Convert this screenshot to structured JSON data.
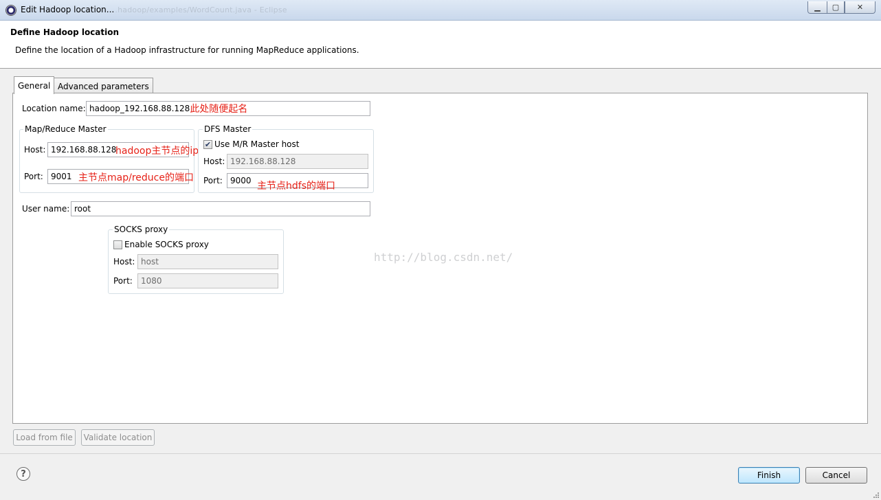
{
  "window": {
    "title": "Edit Hadoop location...",
    "background_path": "...hadoop/examples/WordCount.java - Eclipse"
  },
  "header": {
    "title": "Define Hadoop location",
    "description": "Define the location of a Hadoop infrastructure for running MapReduce applications."
  },
  "tabs": [
    {
      "label": "General",
      "active": true
    },
    {
      "label": "Advanced parameters",
      "active": false
    }
  ],
  "general": {
    "location_name": {
      "label": "Location name:",
      "value": "hadoop_192.168.88.128",
      "annotation": "此处随便起名"
    },
    "mr_master": {
      "legend": "Map/Reduce Master",
      "host_label": "Host:",
      "host_value": "192.168.88.128",
      "host_annotation": "hadoop主节点的ip",
      "port_label": "Port:",
      "port_value": "9001",
      "port_annotation": "主节点map/reduce的端口"
    },
    "dfs_master": {
      "legend": "DFS Master",
      "use_mr_label": "Use M/R Master host",
      "use_mr_checked": true,
      "check_glyph": "✔",
      "host_label": "Host:",
      "host_value": "192.168.88.128",
      "port_label": "Port:",
      "port_value": "9000",
      "port_annotation": "主节点hdfs的端口"
    },
    "user_name": {
      "label": "User name:",
      "value": "root"
    },
    "socks": {
      "legend": "SOCKS proxy",
      "enable_label": "Enable SOCKS proxy",
      "enable_checked": false,
      "host_label": "Host:",
      "host_value": "host",
      "port_label": "Port:",
      "port_value": "1080"
    }
  },
  "watermark": "http://blog.csdn.net/",
  "buttons": {
    "load_from_file": "Load from file",
    "validate_location": "Validate location",
    "finish": "Finish",
    "cancel": "Cancel",
    "help_glyph": "?"
  },
  "window_controls": {
    "minimize": "▁",
    "maximize": "▢",
    "close": "✕"
  },
  "colors": {
    "annotation": "#e62117",
    "finish_border": "#3c7fb1"
  }
}
